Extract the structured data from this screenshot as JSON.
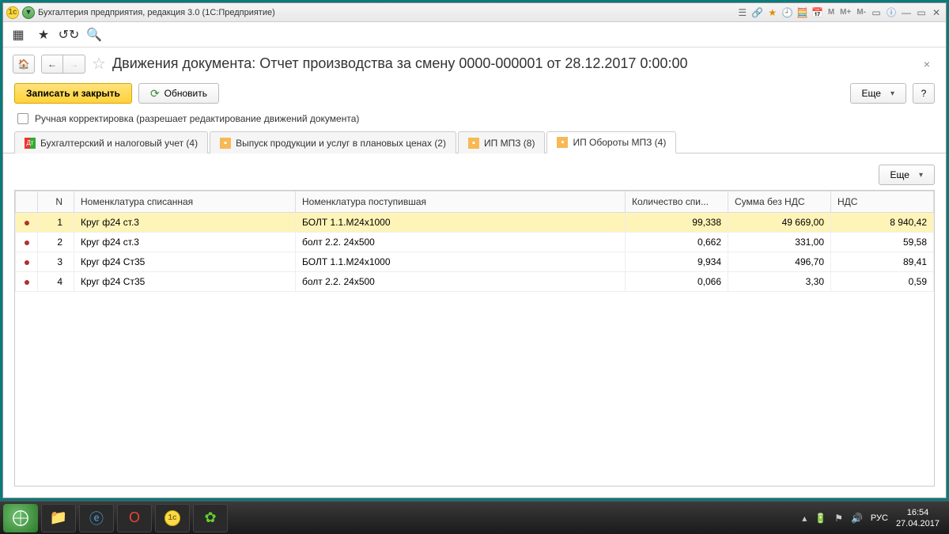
{
  "titlebar": {
    "text": "Бухгалтерия предприятия, редакция 3.0  (1С:Предприятие)"
  },
  "system_buttons": {
    "m": "M",
    "mp": "M+",
    "mm": "M-"
  },
  "page": {
    "title": "Движения документа: Отчет производства за смену 0000-000001 от 28.12.2017 0:00:00"
  },
  "buttons": {
    "save_close": "Записать и закрыть",
    "refresh": "Обновить",
    "more": "Еще",
    "help": "?"
  },
  "checkbox": {
    "label": "Ручная корректировка (разрешает редактирование движений документа)"
  },
  "tabs": [
    {
      "label": "Бухгалтерский и налоговый учет (4)"
    },
    {
      "label": "Выпуск продукции и услуг в плановых ценах (2)"
    },
    {
      "label": "ИП МПЗ (8)"
    },
    {
      "label": "ИП Обороты МПЗ (4)"
    }
  ],
  "table": {
    "headers": {
      "n": "N",
      "nom_out": "Номенклатура списанная",
      "nom_in": "Номенклатура поступившая",
      "qty": "Количество спи...",
      "sum": "Сумма без НДС",
      "vat": "НДС"
    },
    "rows": [
      {
        "n": "1",
        "nom_out": "Круг ф24 ст.3",
        "nom_in": "БОЛТ 1.1.М24х1000",
        "qty": "99,338",
        "sum": "49 669,00",
        "vat": "8 940,42"
      },
      {
        "n": "2",
        "nom_out": "Круг ф24 ст.3",
        "nom_in": "болт 2.2. 24х500",
        "qty": "0,662",
        "sum": "331,00",
        "vat": "59,58"
      },
      {
        "n": "3",
        "nom_out": "Круг ф24 Ст35",
        "nom_in": "БОЛТ 1.1.М24х1000",
        "qty": "9,934",
        "sum": "496,70",
        "vat": "89,41"
      },
      {
        "n": "4",
        "nom_out": "Круг ф24 Ст35",
        "nom_in": "болт 2.2. 24х500",
        "qty": "0,066",
        "sum": "3,30",
        "vat": "0,59"
      }
    ]
  },
  "taskbar": {
    "lang": "РУС",
    "time": "16:54",
    "date": "27.04.2017"
  }
}
